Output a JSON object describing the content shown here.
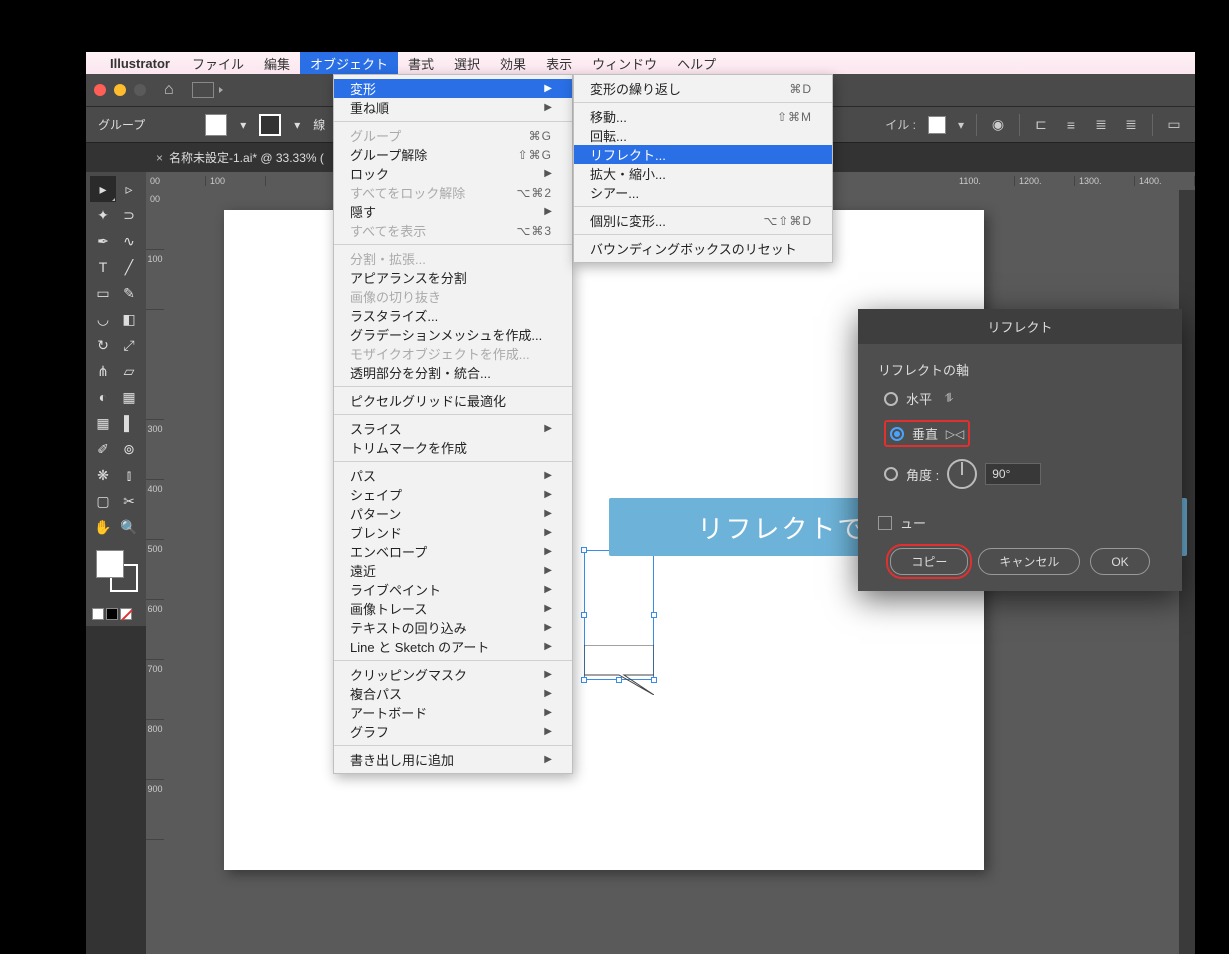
{
  "menubar": {
    "app": "Illustrator",
    "items": [
      "ファイル",
      "編集",
      "オブジェクト",
      "書式",
      "選択",
      "効果",
      "表示",
      "ウィンドウ",
      "ヘルプ"
    ],
    "active_index": 2
  },
  "controlbar": {
    "label": "グループ",
    "stroke_label": "線",
    "style_label": "イル :"
  },
  "tab": {
    "title": "名称未設定-1.ai* @ 33.33% ("
  },
  "object_menu": [
    {
      "label": "変形",
      "arrow": true,
      "hl": true
    },
    {
      "label": "重ね順",
      "arrow": true
    },
    {
      "sep": true
    },
    {
      "label": "グループ",
      "shortcut": "⌘G",
      "disabled": true
    },
    {
      "label": "グループ解除",
      "shortcut": "⇧⌘G"
    },
    {
      "label": "ロック",
      "arrow": true
    },
    {
      "label": "すべてをロック解除",
      "shortcut": "⌥⌘2",
      "disabled": true
    },
    {
      "label": "隠す",
      "arrow": true
    },
    {
      "label": "すべてを表示",
      "shortcut": "⌥⌘3",
      "disabled": true
    },
    {
      "sep": true
    },
    {
      "label": "分割・拡張...",
      "disabled": true
    },
    {
      "label": "アピアランスを分割"
    },
    {
      "label": "画像の切り抜き",
      "disabled": true
    },
    {
      "label": "ラスタライズ..."
    },
    {
      "label": "グラデーションメッシュを作成..."
    },
    {
      "label": "モザイクオブジェクトを作成...",
      "disabled": true
    },
    {
      "label": "透明部分を分割・統合..."
    },
    {
      "sep": true
    },
    {
      "label": "ピクセルグリッドに最適化"
    },
    {
      "sep": true
    },
    {
      "label": "スライス",
      "arrow": true
    },
    {
      "label": "トリムマークを作成"
    },
    {
      "sep": true
    },
    {
      "label": "パス",
      "arrow": true
    },
    {
      "label": "シェイプ",
      "arrow": true
    },
    {
      "label": "パターン",
      "arrow": true
    },
    {
      "label": "ブレンド",
      "arrow": true
    },
    {
      "label": "エンベロープ",
      "arrow": true
    },
    {
      "label": "遠近",
      "arrow": true
    },
    {
      "label": "ライブペイント",
      "arrow": true
    },
    {
      "label": "画像トレース",
      "arrow": true
    },
    {
      "label": "テキストの回り込み",
      "arrow": true
    },
    {
      "label": "Line と Sketch のアート",
      "arrow": true
    },
    {
      "sep": true
    },
    {
      "label": "クリッピングマスク",
      "arrow": true
    },
    {
      "label": "複合パス",
      "arrow": true
    },
    {
      "label": "アートボード",
      "arrow": true
    },
    {
      "label": "グラフ",
      "arrow": true
    },
    {
      "sep": true
    },
    {
      "label": "書き出し用に追加",
      "arrow": true
    }
  ],
  "transform_menu": [
    {
      "label": "変形の繰り返し",
      "shortcut": "⌘D"
    },
    {
      "sep": true
    },
    {
      "label": "移動...",
      "shortcut": "⇧⌘M"
    },
    {
      "label": "回転..."
    },
    {
      "label": "リフレクト...",
      "hl": true
    },
    {
      "label": "拡大・縮小..."
    },
    {
      "label": "シアー..."
    },
    {
      "sep": true
    },
    {
      "label": "個別に変形...",
      "shortcut": "⌥⇧⌘D"
    },
    {
      "sep": true
    },
    {
      "label": "バウンディングボックスのリセット"
    }
  ],
  "dialog": {
    "title": "リフレクト",
    "section": "リフレクトの軸",
    "horizontal": "水平",
    "vertical": "垂直",
    "angle": "角度 :",
    "angle_value": "90°",
    "preview_partial": "ュー",
    "copy": "コピー",
    "cancel": "キャンセル",
    "ok": "OK"
  },
  "callout": {
    "text": "リフレクトで垂直/コピーをする"
  },
  "ruler_top": [
    "00",
    "100",
    "1100.",
    "1200.",
    "1300.",
    "1400."
  ],
  "ruler_left": [
    "00",
    "100",
    "300",
    "400",
    "500",
    "600",
    "700",
    "800",
    "900"
  ]
}
